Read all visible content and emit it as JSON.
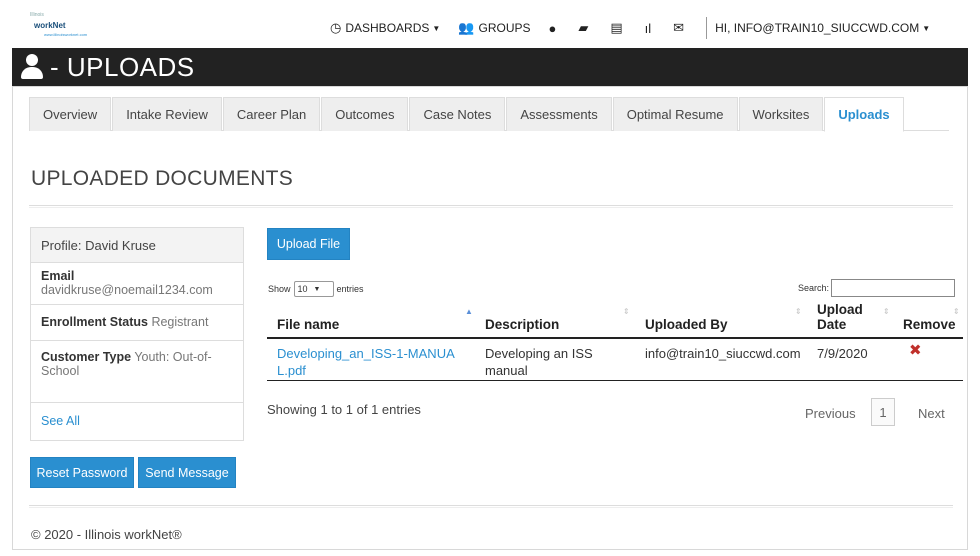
{
  "logo": {
    "line1": "Illinois",
    "line2": "workNet",
    "line3": "www.illinoisworknet.com"
  },
  "nav": {
    "dashboards": "DASHBOARDS",
    "groups": "GROUPS",
    "user_greeting": "HI, INFO@TRAIN10_SIUCCWD.COM"
  },
  "page": {
    "title": "- UPLOADS"
  },
  "tabs": [
    {
      "label": "Overview"
    },
    {
      "label": "Intake Review"
    },
    {
      "label": "Career Plan"
    },
    {
      "label": "Outcomes"
    },
    {
      "label": "Case Notes"
    },
    {
      "label": "Assessments"
    },
    {
      "label": "Optimal Resume"
    },
    {
      "label": "Worksites"
    },
    {
      "label": "Uploads"
    }
  ],
  "section_title": "UPLOADED DOCUMENTS",
  "profile": {
    "header": "Profile: David Kruse",
    "email_label": "Email",
    "email_value": "davidkruse@noemail1234.com",
    "enroll_label": "Enrollment Status",
    "enroll_value": "Registrant",
    "ctype_label": "Customer Type",
    "ctype_value": "Youth: Out-of-School",
    "see_all": "See All"
  },
  "buttons": {
    "reset": "Reset Password",
    "send": "Send Message",
    "upload": "Upload File"
  },
  "table_controls": {
    "show": "Show",
    "entries_value": "10",
    "entries": "entries",
    "search_label": "Search:"
  },
  "table": {
    "columns": [
      "File name",
      "Description",
      "Uploaded By",
      "Upload Date",
      "Remove"
    ],
    "rows": [
      {
        "file_name": "Developing_an_ISS-1-MANUAL.pdf",
        "description": "Developing an ISS manual",
        "uploaded_by": "info@train10_siuccwd.com",
        "date": "7/9/2020",
        "remove": "✖"
      }
    ]
  },
  "pagination": {
    "info": "Showing 1 to 1 of 1 entries",
    "previous": "Previous",
    "page": "1",
    "next": "Next"
  },
  "footer": "© 2020 - Illinois workNet®",
  "colors": {
    "accent": "#2a8fd0",
    "title_bar": "#222222",
    "remove": "#c0302b"
  }
}
